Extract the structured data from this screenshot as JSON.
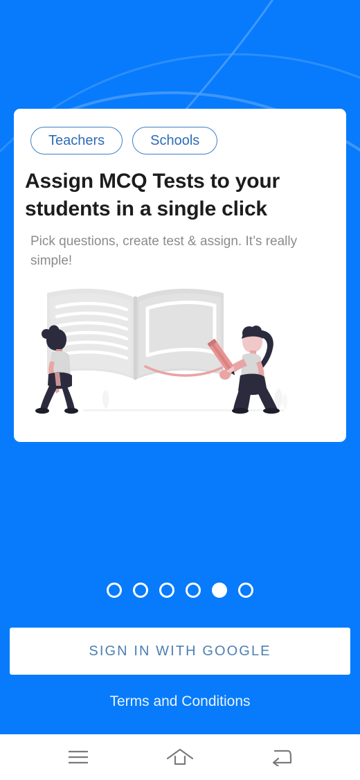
{
  "theme": {
    "background_blue": "#077BFB",
    "card_background": "#FFFFFF",
    "pill_border": "#3A7EC4",
    "pill_text": "#2D6CB5",
    "title_text": "#1C1C1C",
    "subtitle_text": "#8B8B8B",
    "button_text": "#4C7FB2",
    "terms_text": "#E9F3FF",
    "navbar_background": "#FFFFFF",
    "navbar_icon": "#7A7A7A"
  },
  "card": {
    "pills": [
      {
        "label": "Teachers",
        "name": "pill-teachers"
      },
      {
        "label": "Schools",
        "name": "pill-schools"
      }
    ],
    "title": "Assign MCQ Tests to your students in a single click",
    "subtitle": "Pick questions, create test & assign. It’s really simple!",
    "illustration": {
      "name": "students-reading-book-illustration",
      "description": "Two figures standing beside a large open book; the right figure holds a pencil and draws a line on the page"
    }
  },
  "pager": {
    "total_dots": 6,
    "active_index": 4
  },
  "actions": {
    "sign_in_label": "SIGN IN WITH GOOGLE",
    "terms_label": "Terms and Conditions"
  },
  "navbar": {
    "buttons": [
      {
        "label": "Recents",
        "icon": "hamburger-menu-icon"
      },
      {
        "label": "Home",
        "icon": "home-icon"
      },
      {
        "label": "Back",
        "icon": "back-arrow-icon"
      }
    ]
  }
}
